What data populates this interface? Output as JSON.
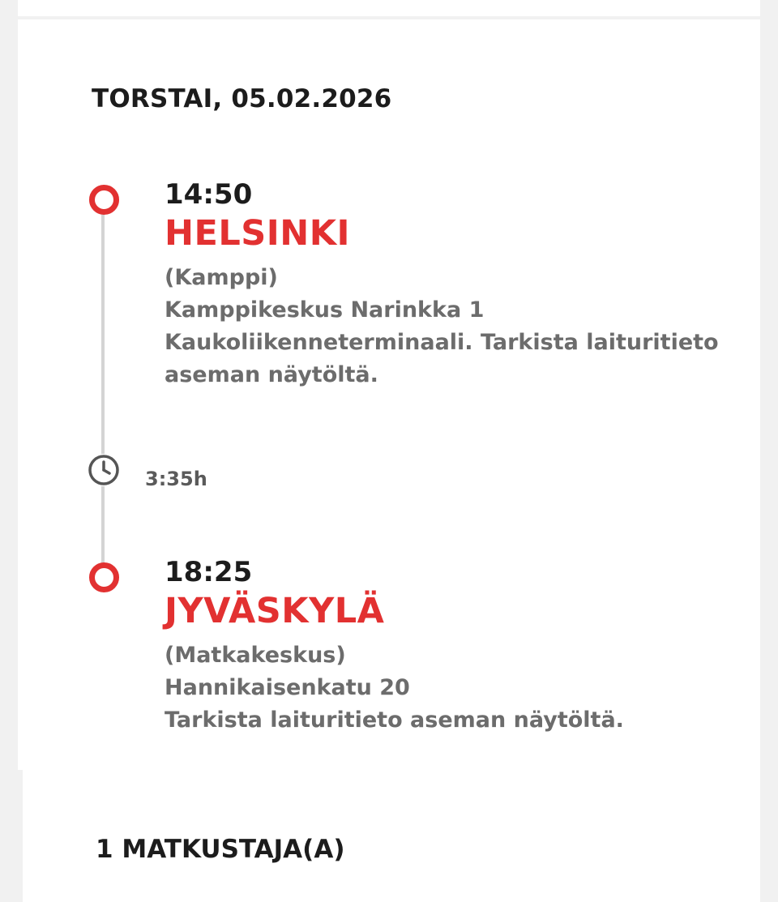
{
  "trip": {
    "date_heading": "TORSTAI, 05.02.2026",
    "departure": {
      "time": "14:50",
      "city": "HELSINKI",
      "station": "(Kamppi)",
      "address": "Kamppikeskus Narinkka 1",
      "note_line1": "Kaukoliikenneterminaali. Tarkista laituritieto",
      "note_line2": "aseman näytöltä."
    },
    "duration": {
      "icon": "clock-icon",
      "value": "3:35h"
    },
    "arrival": {
      "time": "18:25",
      "city": "JYVÄSKYLÄ",
      "station": "(Matkakeskus)",
      "address": "Hannikaisenkatu 20",
      "note_line1": "Tarkista laituritieto aseman näytöltä."
    }
  },
  "passengers": {
    "heading": "1 MATKUSTAJA(A)"
  },
  "colors": {
    "accent": "#e23131",
    "text": "#1c1c1c",
    "muted": "#6c6c6c",
    "timeline": "#d4d4d4"
  }
}
